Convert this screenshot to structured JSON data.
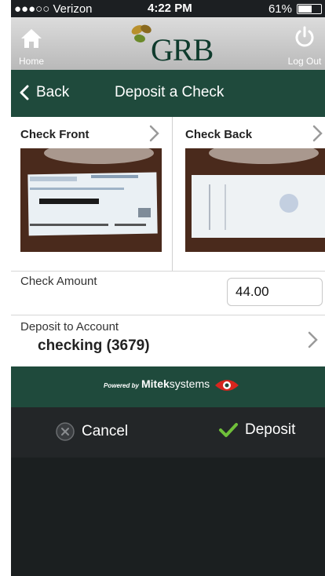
{
  "status_bar": {
    "carrier": "●●●○○ Verizon",
    "time": "4:22 PM",
    "battery": "61%",
    "battery_level": 0.61
  },
  "top_bar": {
    "home_label": "Home",
    "logo_text": "GRB",
    "logout_label": "Log Out"
  },
  "nav": {
    "back_label": "Back",
    "title": "Deposit a Check"
  },
  "checks": {
    "front_label": "Check Front",
    "back_label": "Check Back"
  },
  "amount": {
    "label": "Check Amount",
    "value": "44.00"
  },
  "account": {
    "label": "Deposit to Account",
    "value": "checking (3679)"
  },
  "powered": {
    "prefix": "Powered by",
    "brand_bold": "Mitek",
    "brand_rest": "systems"
  },
  "actions": {
    "cancel_label": "Cancel",
    "deposit_label": "Deposit"
  },
  "colors": {
    "brand_green": "#1f4a3c",
    "logo_green": "#0f3b2d",
    "logo_gold": "#b8902d",
    "check_mark": "#6fbf3a",
    "mitek_red": "#d7261e"
  },
  "icons": {
    "home": "home-icon",
    "logout": "power-icon",
    "back": "chevron-left-icon",
    "disclosure": "chevron-right-icon",
    "cancel": "cancel-circle-icon",
    "deposit": "check-mark-icon",
    "mitek": "eye-logo-icon"
  }
}
